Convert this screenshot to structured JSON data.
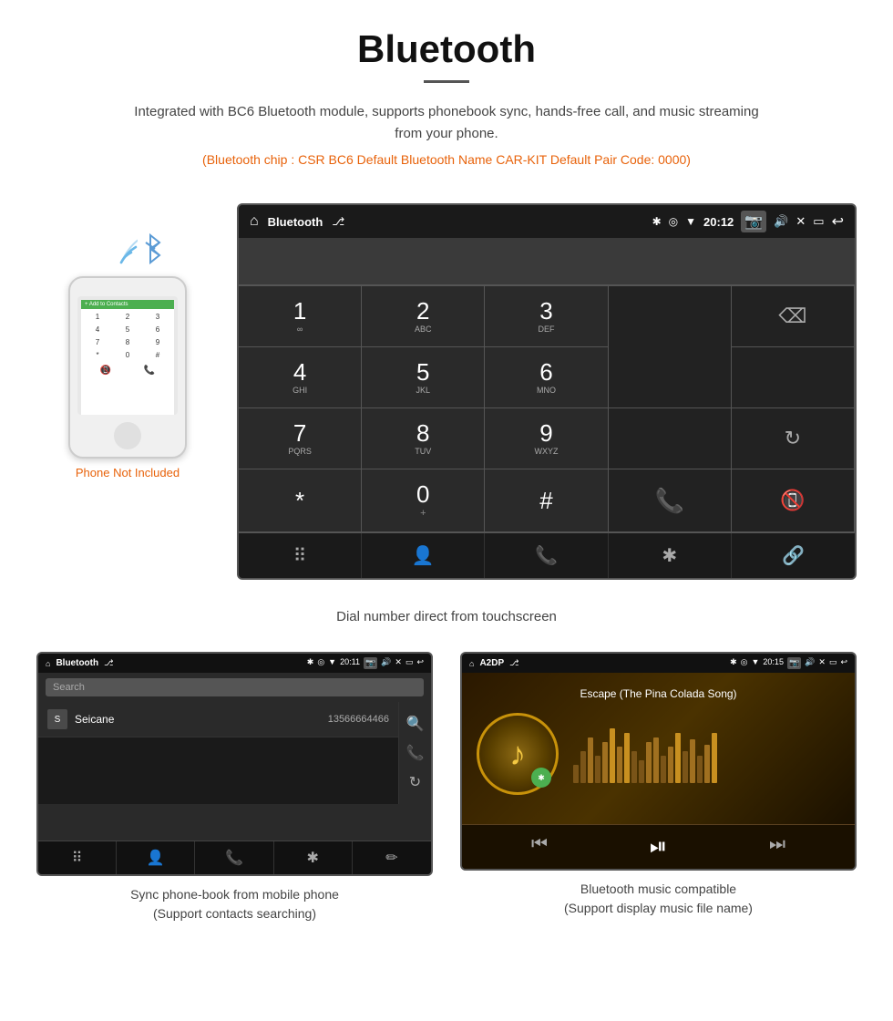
{
  "page": {
    "title": "Bluetooth",
    "subtitle": "Integrated with BC6 Bluetooth module, supports phonebook sync, hands-free call, and music streaming from your phone.",
    "specs": "(Bluetooth chip : CSR BC6    Default Bluetooth Name CAR-KIT     Default Pair Code: 0000)",
    "phone_note": "Phone Not Included",
    "dial_caption": "Dial number direct from touchscreen",
    "bottom_left_caption_line1": "Sync phone-book from mobile phone",
    "bottom_left_caption_line2": "(Support contacts searching)",
    "bottom_right_caption_line1": "Bluetooth music compatible",
    "bottom_right_caption_line2": "(Support display music file name)"
  },
  "car_screen": {
    "status_title": "Bluetooth",
    "time": "20:12",
    "dialpad": [
      {
        "num": "1",
        "sub": "∞"
      },
      {
        "num": "2",
        "sub": "ABC"
      },
      {
        "num": "3",
        "sub": "DEF"
      },
      {
        "num": "",
        "sub": ""
      },
      {
        "num": "⌫",
        "sub": ""
      },
      {
        "num": "4",
        "sub": "GHI"
      },
      {
        "num": "5",
        "sub": "JKL"
      },
      {
        "num": "6",
        "sub": "MNO"
      },
      {
        "num": "",
        "sub": ""
      },
      {
        "num": "",
        "sub": ""
      },
      {
        "num": "7",
        "sub": "PQRS"
      },
      {
        "num": "8",
        "sub": "TUV"
      },
      {
        "num": "9",
        "sub": "WXYZ"
      },
      {
        "num": "",
        "sub": ""
      },
      {
        "num": "↻",
        "sub": ""
      },
      {
        "num": "*",
        "sub": ""
      },
      {
        "num": "0",
        "sub": "+"
      },
      {
        "num": "#",
        "sub": ""
      },
      {
        "num": "📞",
        "sub": ""
      },
      {
        "num": "📵",
        "sub": ""
      }
    ],
    "nav_icons": [
      "⠿",
      "👤",
      "📞",
      "✱",
      "🔗"
    ]
  },
  "phonebook_screen": {
    "status_title": "Bluetooth",
    "time": "20:11",
    "search_placeholder": "Search",
    "contact_letter": "S",
    "contact_name": "Seicane",
    "contact_number": "13566664466",
    "side_icons": [
      "🔍",
      "📞",
      "↻"
    ],
    "nav_icons": [
      "⠿",
      "👤",
      "📞",
      "✱",
      "✏"
    ]
  },
  "music_screen": {
    "status_title": "A2DP",
    "time": "20:15",
    "song_title": "Escape (The Pina Colada Song)",
    "eq_bars": [
      20,
      35,
      50,
      30,
      45,
      60,
      40,
      55,
      35,
      25,
      45,
      50,
      30,
      40,
      55,
      35,
      48,
      30,
      42,
      55
    ],
    "controls": [
      "⏮",
      "⏯",
      "⏭"
    ]
  }
}
